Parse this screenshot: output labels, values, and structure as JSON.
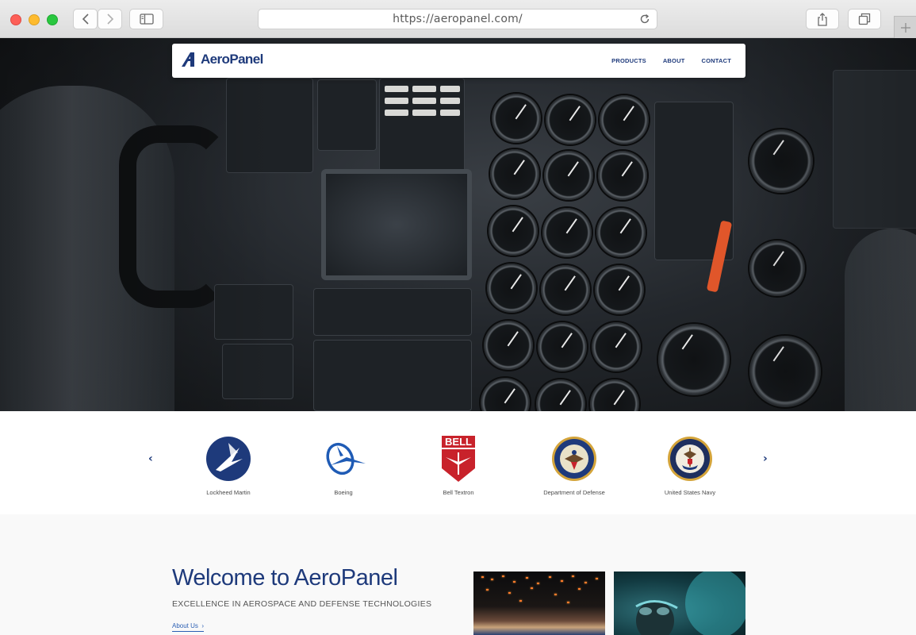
{
  "browser": {
    "url": "https://aeropanel.com/"
  },
  "site": {
    "logo_text": "AeroPanel",
    "nav": [
      {
        "label": "PRODUCTS"
      },
      {
        "label": "ABOUT"
      },
      {
        "label": "CONTACT"
      }
    ]
  },
  "partners": {
    "prev_arrow": "‹",
    "next_arrow": "›",
    "items": [
      {
        "name": "Lockheed Martin",
        "logo": "lockheed-martin-logo"
      },
      {
        "name": "Boeing",
        "logo": "boeing-logo"
      },
      {
        "name": "Bell Textron",
        "logo": "bell-textron-logo",
        "logo_text": "BELL"
      },
      {
        "name": "Department of Defense",
        "logo": "dod-seal"
      },
      {
        "name": "United States Navy",
        "logo": "us-navy-seal"
      }
    ]
  },
  "welcome": {
    "title": "Welcome to AeroPanel",
    "subtitle": "EXCELLENCE IN AEROSPACE AND DEFENSE TECHNOLOGIES",
    "about_link": "About Us",
    "about_chevron": "›"
  },
  "colors": {
    "brand_navy": "#1e3a7b",
    "link_blue": "#2b5fb3",
    "bell_red": "#c8222b",
    "seal_gold": "#d4a43a"
  }
}
